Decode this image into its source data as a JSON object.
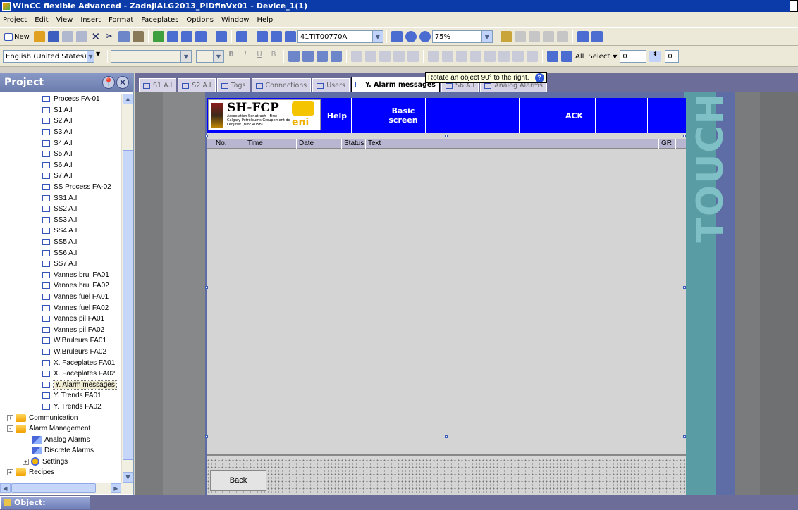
{
  "window": {
    "title": "WinCC flexible Advanced - ZadnjiALG2013_PIDfinVx01 - Device_1(1)"
  },
  "menu": [
    "Project",
    "Edit",
    "View",
    "Insert",
    "Format",
    "Faceplates",
    "Options",
    "Window",
    "Help"
  ],
  "toolbar1": {
    "new_label": "New",
    "tag_combo": "41TIT00770A",
    "zoom_combo": "75%"
  },
  "toolbar2": {
    "language_combo": "English (United States)",
    "all_label": "All",
    "select_label": "Select",
    "select_value": "0",
    "spin_value": "0"
  },
  "tooltip": {
    "text": "Rotate an object 90° to the right."
  },
  "project_panel": {
    "title": "Project",
    "tree": [
      {
        "label": "Process FA-01",
        "type": "screen"
      },
      {
        "label": "S1 A.I",
        "type": "screen"
      },
      {
        "label": "S2 A.I",
        "type": "screen"
      },
      {
        "label": "S3 A.I",
        "type": "screen"
      },
      {
        "label": "S4 A.I",
        "type": "screen"
      },
      {
        "label": "S5 A.I",
        "type": "screen"
      },
      {
        "label": "S6 A.I",
        "type": "screen"
      },
      {
        "label": "S7 A.I",
        "type": "screen"
      },
      {
        "label": "SS Process FA-02",
        "type": "screen"
      },
      {
        "label": "SS1 A.I",
        "type": "screen"
      },
      {
        "label": "SS2 A.I",
        "type": "screen"
      },
      {
        "label": "SS3 A.I",
        "type": "screen"
      },
      {
        "label": "SS4 A.I",
        "type": "screen"
      },
      {
        "label": "SS5 A.I",
        "type": "screen"
      },
      {
        "label": "SS6 A.I",
        "type": "screen"
      },
      {
        "label": "SS7 A.I",
        "type": "screen"
      },
      {
        "label": "Vannes brul FA01",
        "type": "screen"
      },
      {
        "label": "Vannes brul FA02",
        "type": "screen"
      },
      {
        "label": "Vannes fuel FA01",
        "type": "screen"
      },
      {
        "label": "Vannes fuel FA02",
        "type": "screen"
      },
      {
        "label": "Vannes pil FA01",
        "type": "screen"
      },
      {
        "label": "Vannes pil FA02",
        "type": "screen"
      },
      {
        "label": "W.Bruleurs FA01",
        "type": "screen"
      },
      {
        "label": "W.Bruleurs FA02",
        "type": "screen"
      },
      {
        "label": "X. Faceplates FA01",
        "type": "screen"
      },
      {
        "label": "X. Faceplates FA02",
        "type": "screen"
      },
      {
        "label": "Y. Alarm messages",
        "type": "screen",
        "selected": true
      },
      {
        "label": "Y. Trends FA01",
        "type": "screen"
      },
      {
        "label": "Y. Trends FA02",
        "type": "screen"
      },
      {
        "label": "Communication",
        "type": "folder",
        "expander": "+"
      },
      {
        "label": "Alarm Management",
        "type": "folder",
        "expander": "-"
      },
      {
        "label": "Analog Alarms",
        "type": "alarm"
      },
      {
        "label": "Discrete Alarms",
        "type": "alarm"
      },
      {
        "label": "Settings",
        "type": "settings",
        "expander": "+"
      },
      {
        "label": "Recipes",
        "type": "folder",
        "expander": "+"
      }
    ]
  },
  "tabs": [
    {
      "label": "S1 A.I",
      "active": false
    },
    {
      "label": "S2 A.I",
      "active": false
    },
    {
      "label": "Tags",
      "active": false
    },
    {
      "label": "Connections",
      "active": false
    },
    {
      "label": "Users",
      "active": false
    },
    {
      "label": "Y. Alarm messages",
      "active": true
    },
    {
      "label": "S6 A.I",
      "active": false
    },
    {
      "label": "Analog Alarms",
      "active": false
    }
  ],
  "hmi": {
    "logo_title": "SH-FCP",
    "logo_sub": "Association Sonatrach - First Calgary Petroleums Groupement de Ledjmet (Bloc 405b)",
    "logo_brand": "eni",
    "help_label": "Help",
    "basic_screen_label": "Basic screen",
    "ack_label": "ACK",
    "touch_label": "TOUCH",
    "columns": [
      "No.",
      "Time",
      "Date",
      "Status",
      "Text",
      "GR"
    ],
    "back_label": "Back"
  },
  "statusbar": {
    "object_label": "Object:"
  }
}
